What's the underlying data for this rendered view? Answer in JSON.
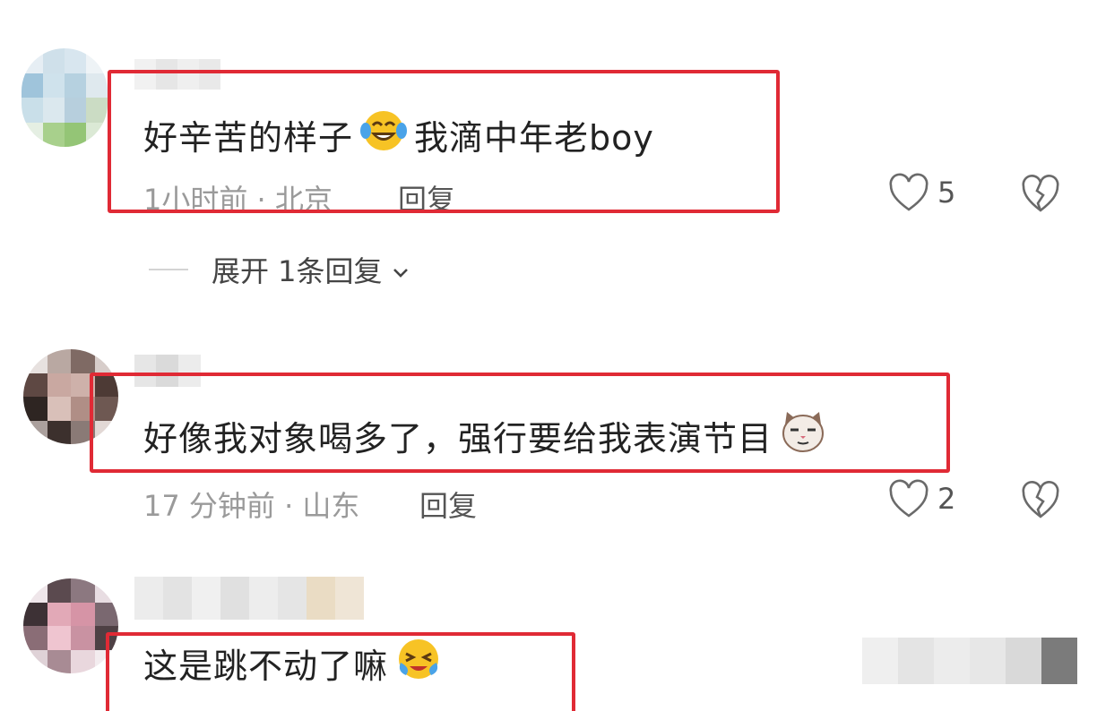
{
  "comments": [
    {
      "text_before": "好辛苦的样子",
      "emoji": "laughing-crying-face-emoji",
      "text_after": "我滴中年老boy",
      "meta": "1小时前 · 北京",
      "reply_label": "回复",
      "like_count": "5",
      "expand_label": "展开 1条回复"
    },
    {
      "text_before": "好像我对象喝多了，强行要给我表演节目",
      "emoji": "smirking-cat-face-emoji",
      "text_after": "",
      "meta": "17 分钟前 · 山东",
      "reply_label": "回复",
      "like_count": "2"
    },
    {
      "text_before": "这是跳不动了嘛",
      "emoji": "crying-face-emoji",
      "text_after": ""
    }
  ],
  "colors": {
    "highlight": "#e02a35",
    "meta_text": "#9a9a9a",
    "icon_stroke": "#6a6a6a"
  },
  "icons": {
    "like": "heart-outline-icon",
    "dislike": "broken-heart-icon",
    "expand": "chevron-down-icon"
  }
}
